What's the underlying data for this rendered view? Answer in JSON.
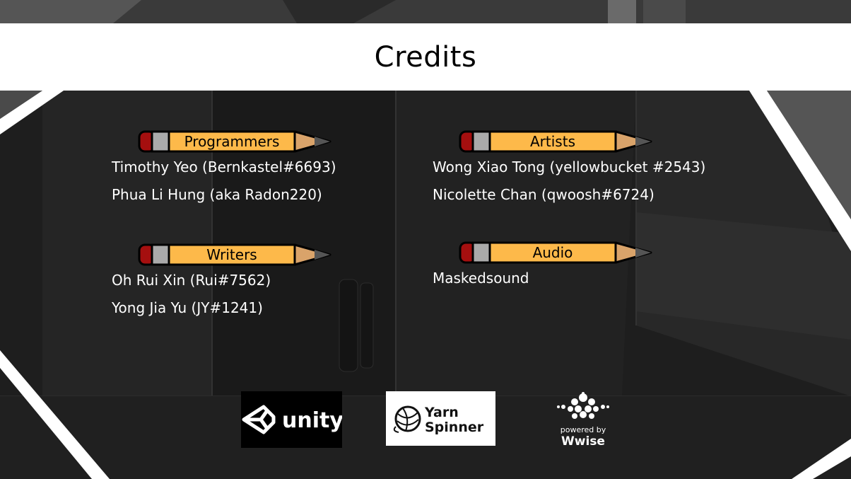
{
  "header": {
    "title": "Credits"
  },
  "sections": [
    {
      "title": "Programmers",
      "names": [
        "Timothy Yeo (Bernkastel#6693)",
        "Phua Li Hung (aka Radon220)"
      ]
    },
    {
      "title": "Artists",
      "names": [
        "Wong Xiao Tong (yellowbucket #2543)",
        "Nicolette Chan (qwoosh#6724)"
      ]
    },
    {
      "title": "Writers",
      "names": [
        "Oh Rui Xin (Rui#7562)",
        "Yong Jia Yu (JY#1241)"
      ]
    },
    {
      "title": "Audio",
      "names": [
        "Maskedsound"
      ]
    }
  ],
  "logos": {
    "unity": "unity",
    "yarn_line1": "Yarn",
    "yarn_line2": "Spinner",
    "wwise_tag": "powered by",
    "wwise_name": "Wwise"
  },
  "colors": {
    "pencil_body": "#fdb94a",
    "pencil_eraser": "#a50f0f",
    "pencil_ferrule": "#aaaaaa",
    "pencil_wood": "#d9a36a",
    "pencil_lead": "#555555"
  }
}
